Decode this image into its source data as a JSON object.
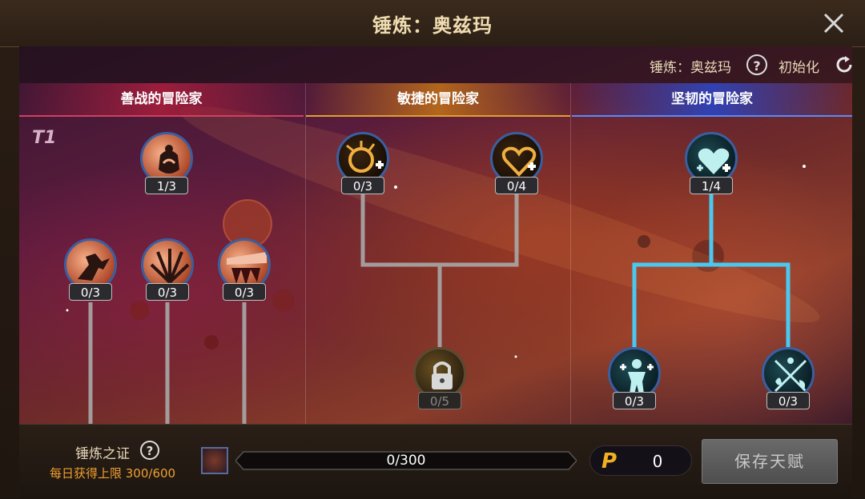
{
  "header": {
    "title": "锤炼：奥兹玛"
  },
  "toolbar": {
    "forge_label": "锤炼：奥兹玛",
    "help_glyph": "?",
    "reset_label": "初始化"
  },
  "tier_label": "T1",
  "columns": [
    {
      "title": "善战的冒险家",
      "accent": "#d04060"
    },
    {
      "title": "敏捷的冒险家",
      "accent": "#e0a030"
    },
    {
      "title": "坚韧的冒险家",
      "accent": "#5a8aff"
    }
  ],
  "nodes": {
    "warrior_top": {
      "count": "1/3",
      "icon": "skull-pot-icon"
    },
    "warrior_a": {
      "count": "0/3",
      "icon": "charging-figure-icon"
    },
    "warrior_b": {
      "count": "0/3",
      "icon": "claw-burst-icon"
    },
    "warrior_c": {
      "count": "0/3",
      "icon": "blood-blade-icon"
    },
    "agile_a": {
      "count": "0/3",
      "icon": "crit-plus-icon"
    },
    "agile_b": {
      "count": "0/4",
      "icon": "heart-plus-icon"
    },
    "agile_locked": {
      "count": "0/5",
      "icon": "padlock-icon"
    },
    "tough_top": {
      "count": "1/4",
      "icon": "heart-shield-icon"
    },
    "tough_a": {
      "count": "0/3",
      "icon": "body-plus-icon"
    },
    "tough_b": {
      "count": "0/3",
      "icon": "elements-cross-icon"
    }
  },
  "footer": {
    "proof_label": "锤炼之证",
    "help_glyph": "?",
    "daily_limit": "每日获得上限 300/600",
    "progress_text": "0/300",
    "progress_fraction": 0,
    "points_symbol": "P",
    "points_value": "0",
    "save_label": "保存天赋"
  },
  "colors": {
    "active_line": "#4ac8f0",
    "inactive_line": "#a8a8a8",
    "points": "#f0b020"
  }
}
